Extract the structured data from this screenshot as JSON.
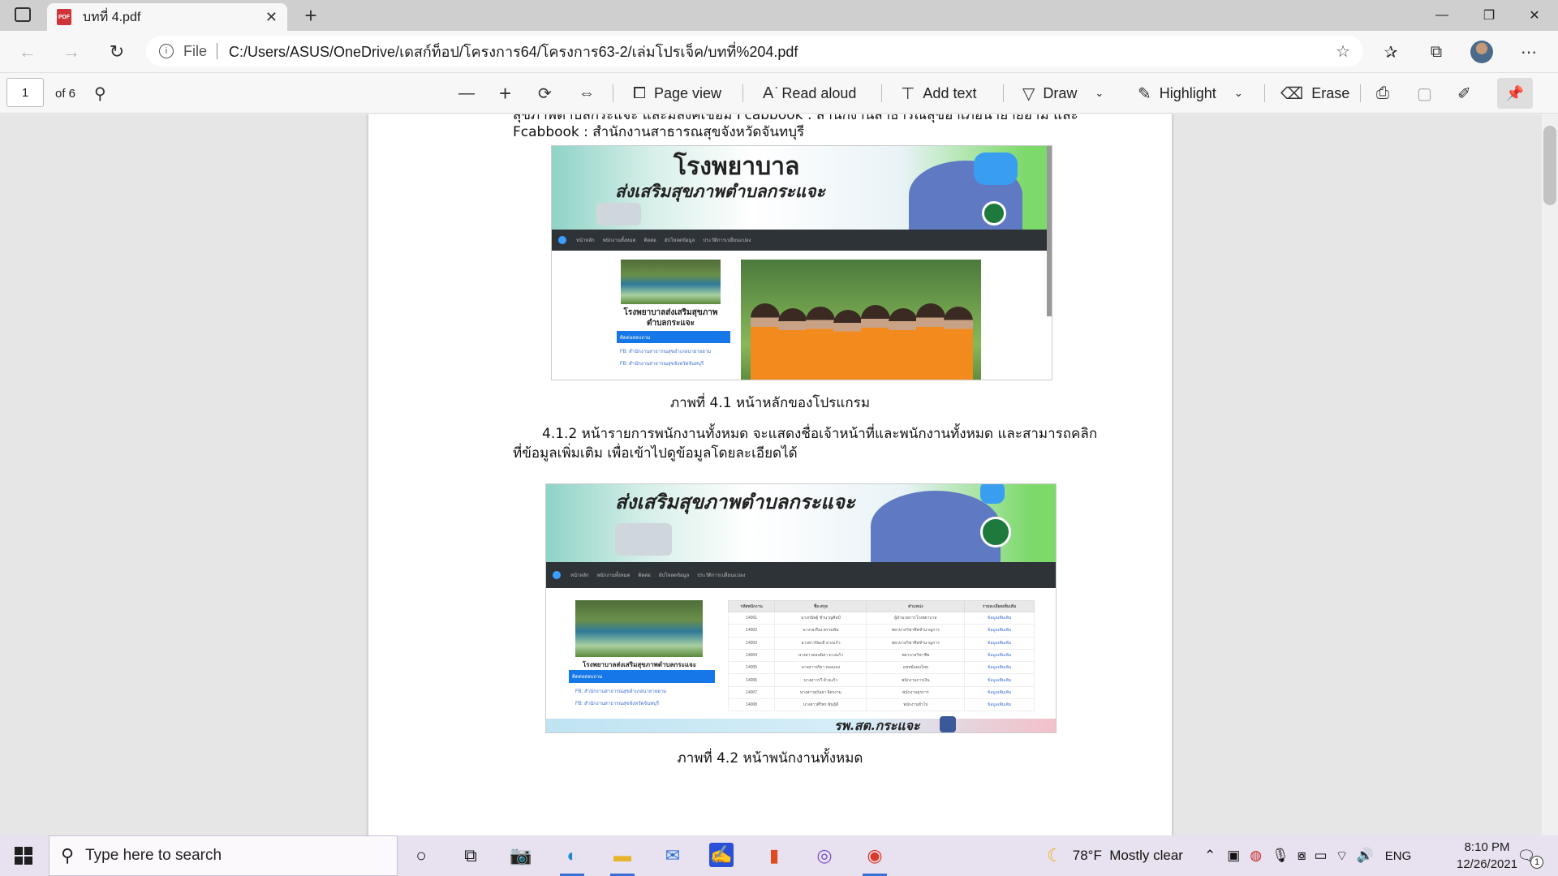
{
  "browser": {
    "tab_title": "บทที่ 4.pdf",
    "file_label": "File",
    "url": "C:/Users/ASUS/OneDrive/เดสก์ท็อป/โครงการ64/โครงการ63-2/เล่มโปรเจ็ค/บทที่%204.pdf"
  },
  "pdf_toolbar": {
    "page_number": "1",
    "page_count": "of 6",
    "page_view": "Page view",
    "read_aloud": "Read aloud",
    "add_text": "Add text",
    "draw": "Draw",
    "highlight": "Highlight",
    "erase": "Erase"
  },
  "document": {
    "top_line_1": "สุขภาพตำบลกระแจะ และมีลิงค์เชื่อม Fcabbook : สำนักงานสาธารณสุขอำเภอนายายอาม และ",
    "top_line_2": "Fcabbook : สำนักงานสาธารณสุขจังหวัดจันทบุรี",
    "caption_1": "ภาพที่ 4.1 หน้าหลักของโปรแกรม",
    "para_line_1": "4.1.2 หน้ารายการพนักงานทั้งหมด จะแสดงชื่อเจ้าหน้าที่และพนักงานทั้งหมด และสามารถคลิก",
    "para_line_2": "ที่ข้อมูลเพิ่มเติม เพื่อเข้าไปดูข้อมูลโดยละเอียดได้",
    "caption_2": "ภาพที่ 4.2 หน้าพนักงานทั้งหมด"
  },
  "figure1": {
    "banner_title": "โรงพยาบาล",
    "banner_subtitle": "ส่งเสริมสุขภาพตำบลกระแจะ",
    "hospital_label_1": "โรงพยาบาลส่งเสริมสุขภาพ",
    "hospital_label_2": "ตำบลกระแจะ",
    "blue_button": "ติดต่อสอบถาม",
    "link_1": "FB: สำนักงานสาธารณสุขอำเภอนายายอาม",
    "link_2": "FB: สำนักงานสาธารณสุขจังหวัดจันทบุรี"
  },
  "figure2": {
    "banner_subtitle": "ส่งเสริมสุขภาพตำบลกระแจะ",
    "hospital_label": "โรงพยาบาลส่งเสริมสุขภาพตำบลกระแจะ",
    "blue_button": "ติดต่อสอบถาม",
    "footer_text": "รพ.สต.กระแจะ",
    "table_headers": [
      "รหัสพนักงาน",
      "ชื่อ-สกุล",
      "ตำแหน่ง",
      "รายละเอียดเพิ่มเติม"
    ],
    "table_rows": [
      [
        "14001",
        "นางกนิษฐ์ ชำนาญศิลป์",
        "ผู้อำนวยการโรงพยาบาล",
        "ข้อมูลเพิ่มเติม"
      ],
      [
        "14002",
        "นางรจเรือง ตรรมพัน",
        "พยาบาลวิชาชีพชำนาญการ",
        "ข้อมูลเพิ่มเติม"
      ],
      [
        "14003",
        "นางสาวปิยะดี ดวงแก้ว",
        "พยาบาลวิชาชีพชำนาญการ",
        "ข้อมูลเพิ่มเติม"
      ],
      [
        "14004",
        "นางสาวดอนนิสา ดวงแก้ว",
        "พยาบาลวิชาชีพ",
        "ข้อมูลเพิ่มเติม"
      ],
      [
        "14005",
        "นางสาวจริยา ทองแดง",
        "แพทย์แผนไทย",
        "ข้อมูลเพิ่มเติม"
      ],
      [
        "14006",
        "นางสาวรวี ด้วงแก้ว",
        "พนักงานการเงิน",
        "ข้อมูลเพิ่มเติม"
      ],
      [
        "14007",
        "นางสาวสุกัลยา จิตรงาม",
        "พนักงานธุรการ",
        "ข้อมูลเพิ่มเติม"
      ],
      [
        "14008",
        "นางสาวศิริพร พันธุ์ดี",
        "พนักงานทั่วไป",
        "ข้อมูลเพิ่มเติม"
      ]
    ]
  },
  "taskbar": {
    "search_placeholder": "Type here to search",
    "weather": "78°F  Mostly clear",
    "language": "ENG",
    "time": "8:10 PM",
    "date": "12/26/2021",
    "notification_count": "1"
  }
}
